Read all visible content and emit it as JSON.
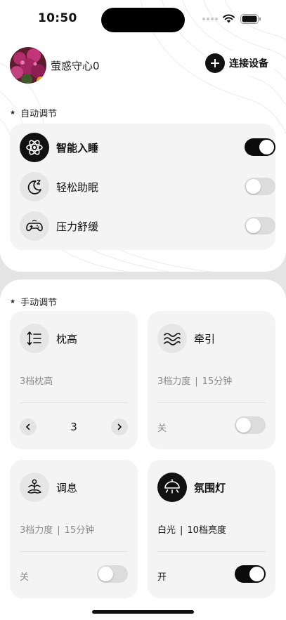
{
  "status_bar": {
    "time": "10:50"
  },
  "profile": {
    "name": "萤惑守心0"
  },
  "header": {
    "connect_label": "连接设备"
  },
  "auto_section": {
    "title": "自动调节",
    "items": [
      {
        "label": "智能入睡",
        "icon": "atom-icon",
        "enabled": true
      },
      {
        "label": "轻松助眠",
        "icon": "moon-zz-icon",
        "enabled": false
      },
      {
        "label": "压力舒缓",
        "icon": "gamepad-icon",
        "enabled": false
      }
    ]
  },
  "manual_section": {
    "title": "手动调节",
    "pillow": {
      "title": "枕高",
      "info": "3档枕高",
      "value": "3",
      "icon": "height-adjust-icon"
    },
    "traction": {
      "title": "牵引",
      "info_level": "3档力度",
      "info_time": "15分钟",
      "status": "关",
      "enabled": false,
      "icon": "waves-icon"
    },
    "breath": {
      "title": "调息",
      "info_level": "3档力度",
      "info_time": "15分钟",
      "status": "关",
      "enabled": false,
      "icon": "meditation-icon"
    },
    "ambient": {
      "title": "氛围灯",
      "info_color": "白光",
      "info_brightness": "10档亮度",
      "status": "开",
      "enabled": true,
      "icon": "lamp-icon"
    }
  },
  "separator": "|",
  "colors": {
    "accent": "#111111",
    "card": "#f4f4f4",
    "toggle_off": "#dcdcdc",
    "muted_text": "#8a8a8a"
  }
}
